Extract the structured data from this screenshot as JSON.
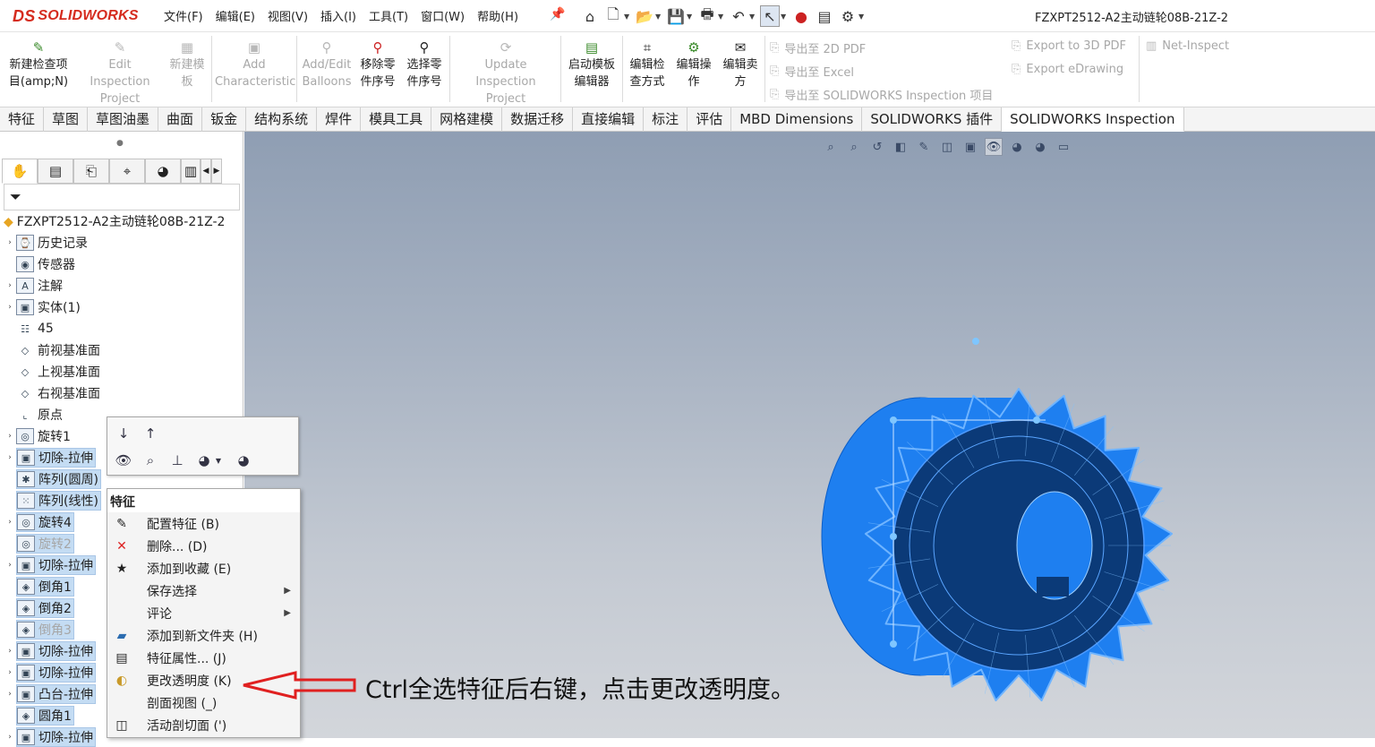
{
  "app": {
    "logo_text": "SOLIDWORKS",
    "logo_mark": "DS",
    "doc_title": "FZXPT2512-A2主动链轮08B-21Z-2"
  },
  "menu": [
    "文件(F)",
    "编辑(E)",
    "视图(V)",
    "插入(I)",
    "工具(T)",
    "窗口(W)",
    "帮助(H)"
  ],
  "ribbon": {
    "new_item": [
      "新建检查项",
      "目(amp;N)"
    ],
    "edit_project": [
      "Edit Inspection",
      "Project"
    ],
    "new_template": [
      "新建模",
      "板"
    ],
    "add_characteristic": [
      "Add",
      "Characteristic"
    ],
    "add_balloons": [
      "Add/Edit",
      "Balloons"
    ],
    "remove_part": [
      "移除零",
      "件序号"
    ],
    "select_part": [
      "选择零",
      "件序号"
    ],
    "update_project": [
      "Update Inspection",
      "Project"
    ],
    "start_editor": [
      "启动模板",
      "编辑器"
    ],
    "edit_method": [
      "编辑检",
      "查方式"
    ],
    "edit_operation": [
      "编辑操",
      "作"
    ],
    "edit_vendor": [
      "编辑卖",
      "方"
    ],
    "export_2d": "导出至 2D PDF",
    "export_excel": "导出至 Excel",
    "export_sw": "导出至 SOLIDWORKS Inspection 项目",
    "export_3d": "Export to 3D PDF",
    "export_edrawing": "Export eDrawing",
    "net_inspect": "Net-Inspect"
  },
  "tabs": [
    "特征",
    "草图",
    "草图油墨",
    "曲面",
    "钣金",
    "结构系统",
    "焊件",
    "模具工具",
    "网格建模",
    "数据迁移",
    "直接编辑",
    "标注",
    "评估",
    "MBD Dimensions",
    "SOLIDWORKS 插件",
    "SOLIDWORKS Inspection"
  ],
  "active_tab": "SOLIDWORKS Inspection",
  "tree": {
    "root": "FZXPT2512-A2主动链轮08B-21Z-2",
    "items": [
      "历史记录",
      "传感器",
      "注解",
      "实体(1)",
      "45",
      "前视基准面",
      "上视基准面",
      "右视基准面",
      "原点",
      "旋转1",
      "切除-拉伸",
      "阵列(圆周)",
      "阵列(线性)",
      "旋转4",
      "旋转2",
      "切除-拉伸",
      "倒角1",
      "倒角2",
      "倒角3",
      "切除-拉伸",
      "切除-拉伸",
      "凸台-拉伸",
      "圆角1",
      "切除-拉伸"
    ]
  },
  "context_menu": {
    "header": "特征",
    "items": [
      "配置特征 (B)",
      "删除... (D)",
      "添加到收藏 (E)",
      "保存选择",
      "评论",
      "添加到新文件夹 (H)",
      "特征属性... (J)",
      "更改透明度 (K)",
      "剖面视图 (_)",
      "活动剖切面 (')"
    ]
  },
  "annotation": "Ctrl全选特征后右键，点击更改透明度。",
  "colors": {
    "model_blue": "#1e7ff0",
    "model_dark": "#0b3a78",
    "arrow_red": "#e02020",
    "selection": "#c4dcf3"
  }
}
